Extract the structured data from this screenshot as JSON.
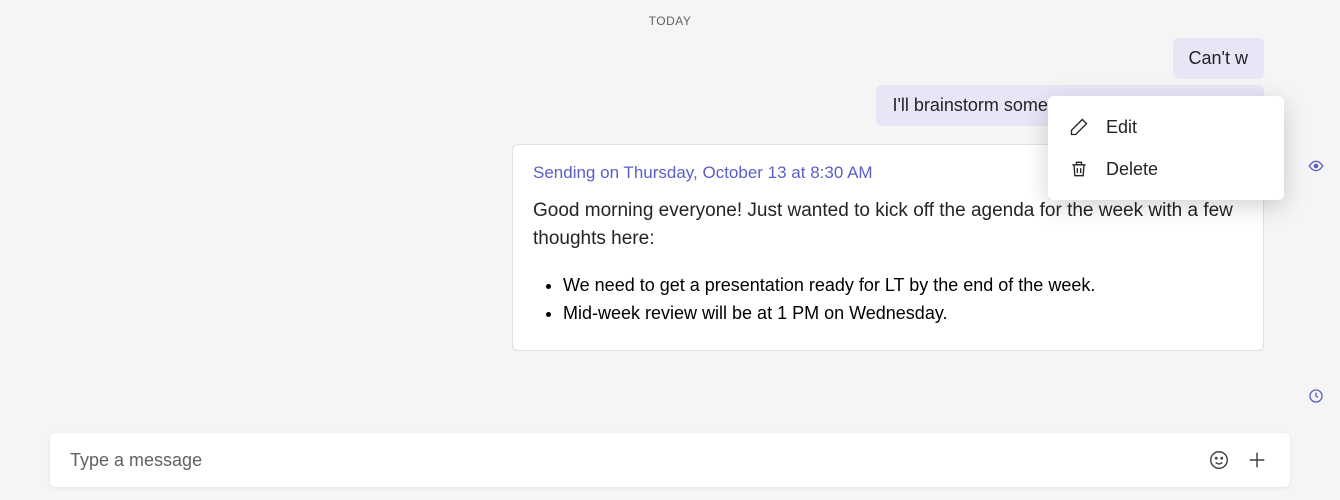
{
  "date_divider": "TODAY",
  "messages": {
    "outgoing_1": "Can't w",
    "outgoing_2": "I'll brainstorm some icebreakers for our team"
  },
  "scheduled": {
    "header": "Sending on Thursday, October 13 at 8:30 AM",
    "body": "Good morning everyone! Just wanted to kick off the agenda for the week with a few thoughts here:",
    "bullets": [
      "We need to get a presentation ready for LT by the end of the week.",
      "Mid-week review will be at 1 PM on Wednesday."
    ],
    "more": "⋯"
  },
  "context_menu": {
    "edit": "Edit",
    "delete": "Delete"
  },
  "compose": {
    "placeholder": "Type a message"
  }
}
